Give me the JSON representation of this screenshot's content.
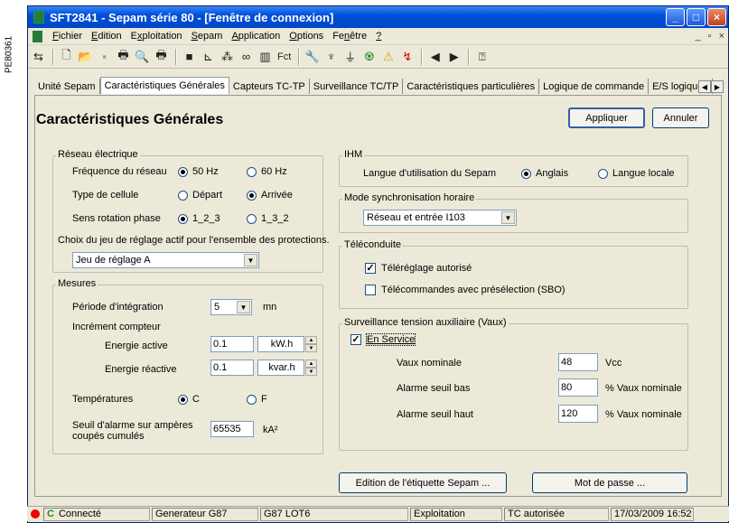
{
  "side_code": "PE80361",
  "window": {
    "title": "SFT2841 - Sepam série 80 - [Fenêtre de connexion]",
    "min": "_",
    "max": "□",
    "close": "×"
  },
  "menu": [
    {
      "pre": "",
      "u": "F",
      "post": "ichier"
    },
    {
      "pre": "",
      "u": "E",
      "post": "dition"
    },
    {
      "pre": "E",
      "u": "x",
      "post": "ploitation"
    },
    {
      "pre": "",
      "u": "S",
      "post": "epam"
    },
    {
      "pre": "",
      "u": "A",
      "post": "pplication"
    },
    {
      "pre": "",
      "u": "O",
      "post": "ptions"
    },
    {
      "pre": "Fe",
      "u": "n",
      "post": "être"
    },
    {
      "pre": "",
      "u": "?",
      "post": ""
    }
  ],
  "mdi": {
    "min": "_",
    "restore": "▫",
    "close": "×"
  },
  "toolbar": {
    "fct": "Fct"
  },
  "tabs": [
    "Unité Sepam",
    "Caractéristiques Générales",
    "Capteurs TC-TP",
    "Surveillance TC/TP",
    "Caractéristiques particulières",
    "Logique de commande",
    "E/S logiques"
  ],
  "tab_scroll": {
    "left": "◀",
    "right": "▶"
  },
  "heading": "Caractéristiques Générales",
  "buttons": {
    "apply": "Appliquer",
    "cancel": "Annuler",
    "edit_label": "Edition de l'étiquette Sepam ...",
    "password": "Mot de passe ..."
  },
  "reseau": {
    "title": "Réseau électrique",
    "freq_label": "Fréquence du réseau",
    "freq_opts": [
      "50 Hz",
      "60 Hz"
    ],
    "cell_label": "Type de cellule",
    "cell_opts": [
      "Départ",
      "Arrivée"
    ],
    "rot_label": "Sens rotation phase",
    "rot_opts": [
      "1_2_3",
      "1_3_2"
    ],
    "choice_label": "Choix du jeu de réglage actif pour l'ensemble des protections.",
    "choice_value": "Jeu de réglage A"
  },
  "mesures": {
    "title": "Mesures",
    "period_label": "Période d'intégration",
    "period_value": "5",
    "period_unit": "mn",
    "counter_label": "Incrément compteur",
    "active_label": "Energie active",
    "active_value": "0.1",
    "active_unit": "kW.h",
    "reactive_label": "Energie réactive",
    "reactive_value": "0.1",
    "reactive_unit": "kvar.h",
    "temp_label": "Températures",
    "temp_opts": [
      "C",
      "F"
    ],
    "seuil_label1": "Seuil d'alarme sur ampères",
    "seuil_label2": "coupés cumulés",
    "seuil_value": "65535",
    "seuil_unit": "kA²"
  },
  "ihm": {
    "title": "IHM",
    "lang_label": "Langue d'utilisation du Sepam",
    "lang_opts": [
      "Anglais",
      "Langue locale"
    ]
  },
  "sync": {
    "title": "Mode synchronisation horaire",
    "value": "Réseau et entrée I103"
  },
  "tele": {
    "title": "Téléconduite",
    "opt1": "Téléréglage autorisé",
    "opt2": "Télécommandes avec présélection (SBO)"
  },
  "vaux": {
    "title": "Surveillance tension auxiliaire (Vaux)",
    "service": "En Service",
    "nominal_label": "Vaux nominale",
    "nominal_value": "48",
    "nominal_unit": "Vcc",
    "low_label": "Alarme seuil bas",
    "low_value": "80",
    "low_unit": "% Vaux nominale",
    "high_label": "Alarme seuil haut",
    "high_value": "120",
    "high_unit": "% Vaux nominale"
  },
  "status": {
    "connected": "Connecté",
    "gen": "Generateur G87",
    "lot": "G87 LOT6",
    "mode": "Exploitation",
    "tc": "TC autorisée",
    "datetime": "17/03/2009 16:52"
  }
}
